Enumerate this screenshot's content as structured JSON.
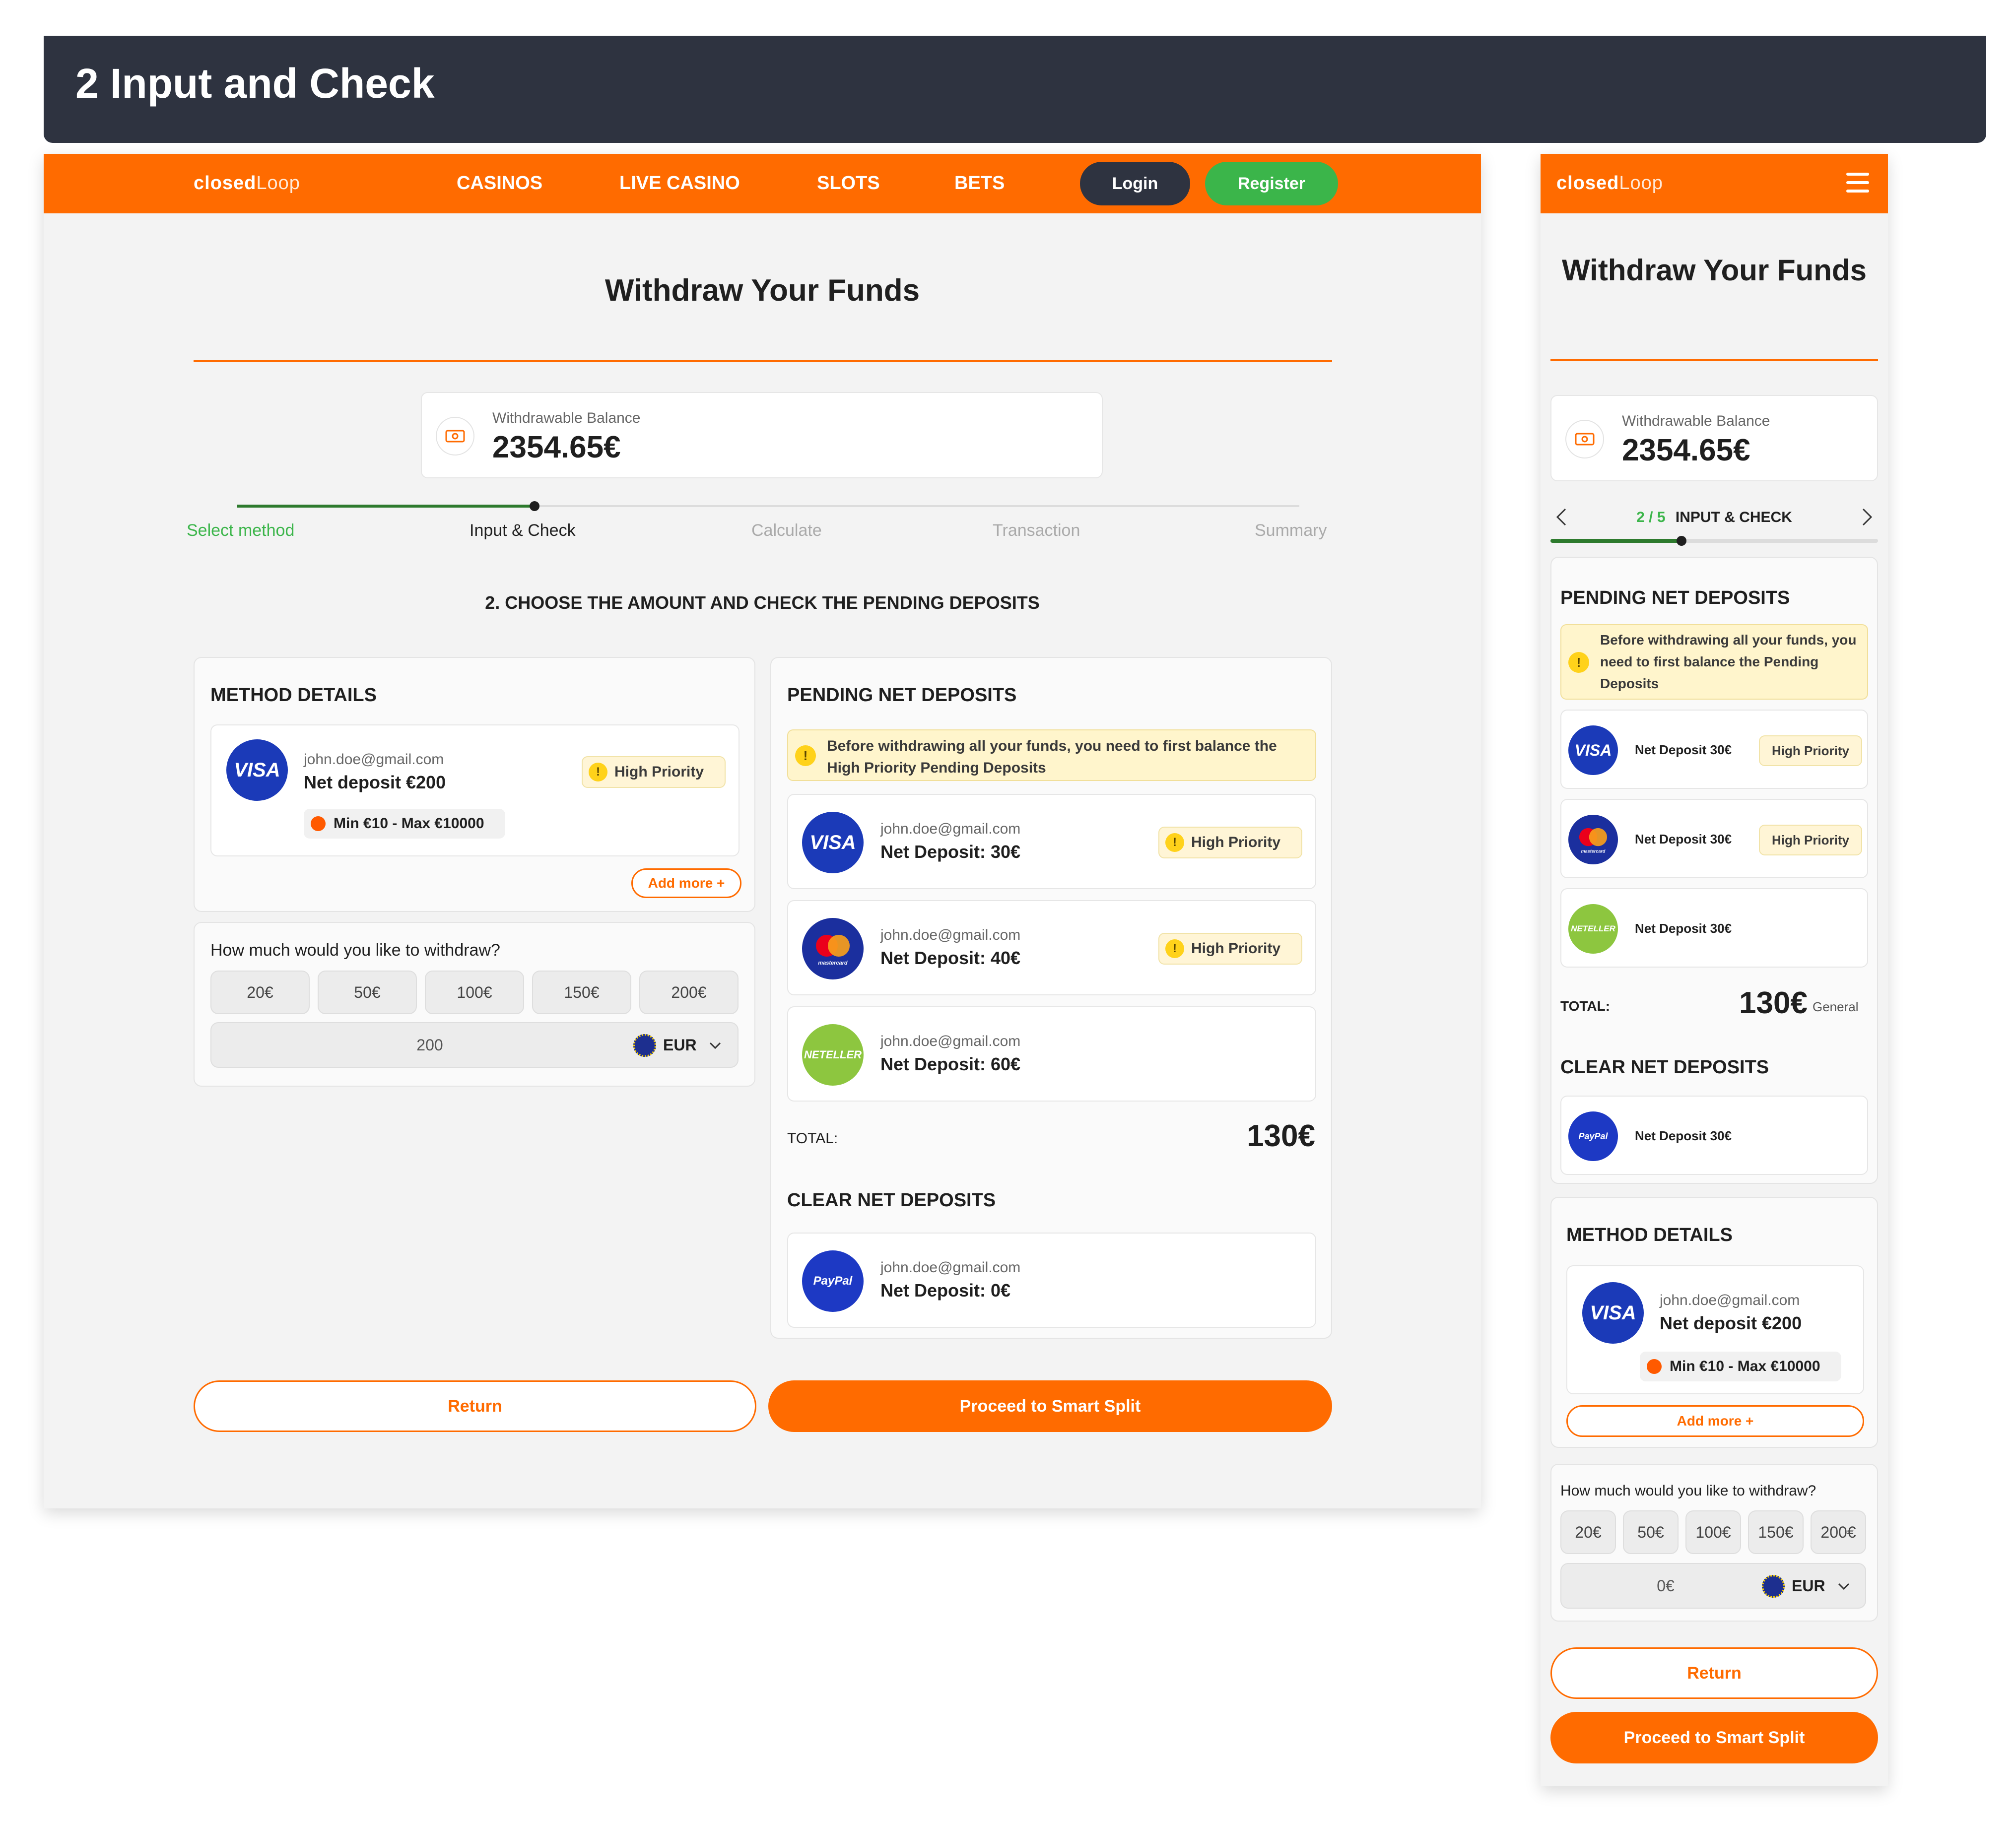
{
  "banner": {
    "title": "2 Input and Check"
  },
  "brand": {
    "word1": "closed",
    "word2": "Loop"
  },
  "nav": {
    "casinos": "CASINOS",
    "live_casino": "LIVE CASINO",
    "slots": "SLOTS",
    "bets": "BETS",
    "login": "Login",
    "register": "Register"
  },
  "page": {
    "title": "Withdraw Your Funds",
    "balance_label": "Withdrawable Balance",
    "balance_value": "2354.65€",
    "steps": [
      "Select method",
      "Input & Check",
      "Calculate",
      "Transaction",
      "Summary"
    ],
    "current_step_index": 2,
    "step_total": 5,
    "step_counter_sep": "/",
    "current_step_label_mobile": "INPUT & CHECK",
    "step_progress": 0.4,
    "section_heading": "2. CHOOSE THE AMOUNT AND CHECK THE PENDING DEPOSITS"
  },
  "method_details": {
    "heading": "METHOD DETAILS",
    "email": "john.doe@gmail.com",
    "net_deposit": "Net deposit €200",
    "badge": "High Priority",
    "limits": "Min €10 - Max €10000",
    "add_more": "Add more +"
  },
  "withdraw": {
    "question": "How much would you like to withdraw?",
    "chips": [
      "20€",
      "50€",
      "100€",
      "150€",
      "200€"
    ],
    "desktop_value": "200",
    "mobile_value": "0€",
    "currency": "EUR"
  },
  "pending": {
    "heading": "PENDING NET DEPOSITS",
    "alert_desktop": "Before withdrawing all your funds, you need to first balance the High Priority Pending Deposits",
    "alert_mobile": "Before withdrawing all your funds, you need to first balance the Pending Deposits",
    "items": [
      {
        "brand": "VISA",
        "email": "john.doe@gmail.com",
        "amount": "Net Deposit: 30€",
        "mobile_amount": "Net Deposit 30€",
        "badge": "High Priority"
      },
      {
        "brand": "mastercard",
        "email": "john.doe@gmail.com",
        "amount": "Net Deposit: 40€",
        "mobile_amount": "Net Deposit 30€",
        "badge": "High Priority"
      },
      {
        "brand": "NETELLER",
        "email": "john.doe@gmail.com",
        "amount": "Net Deposit: 60€",
        "mobile_amount": "Net Deposit 30€",
        "badge": ""
      }
    ],
    "total_label": "TOTAL:",
    "total_value": "130€",
    "total_suffix_mobile": "General"
  },
  "clear": {
    "heading": "CLEAR NET DEPOSITS",
    "item": {
      "brand": "PayPal",
      "email": "john.doe@gmail.com",
      "amount": "Net Deposit: 0€",
      "mobile_amount": "Net Deposit 30€"
    }
  },
  "actions": {
    "return": "Return",
    "proceed": "Proceed to Smart Split"
  },
  "icons": {
    "menu": "hamburger-menu-icon",
    "wallet": "wallet-icon",
    "warning": "warning-icon",
    "chevron_left": "chevron-left-icon",
    "chevron_right": "chevron-right-icon",
    "chevron_down": "chevron-down-icon",
    "eu_flag": "eu-flag-icon"
  },
  "colors": {
    "brand_orange": "#ff6b00",
    "nav_dark": "#2e3340",
    "success_green": "#3bb54a",
    "warning_yellow": "#ffd21a"
  }
}
